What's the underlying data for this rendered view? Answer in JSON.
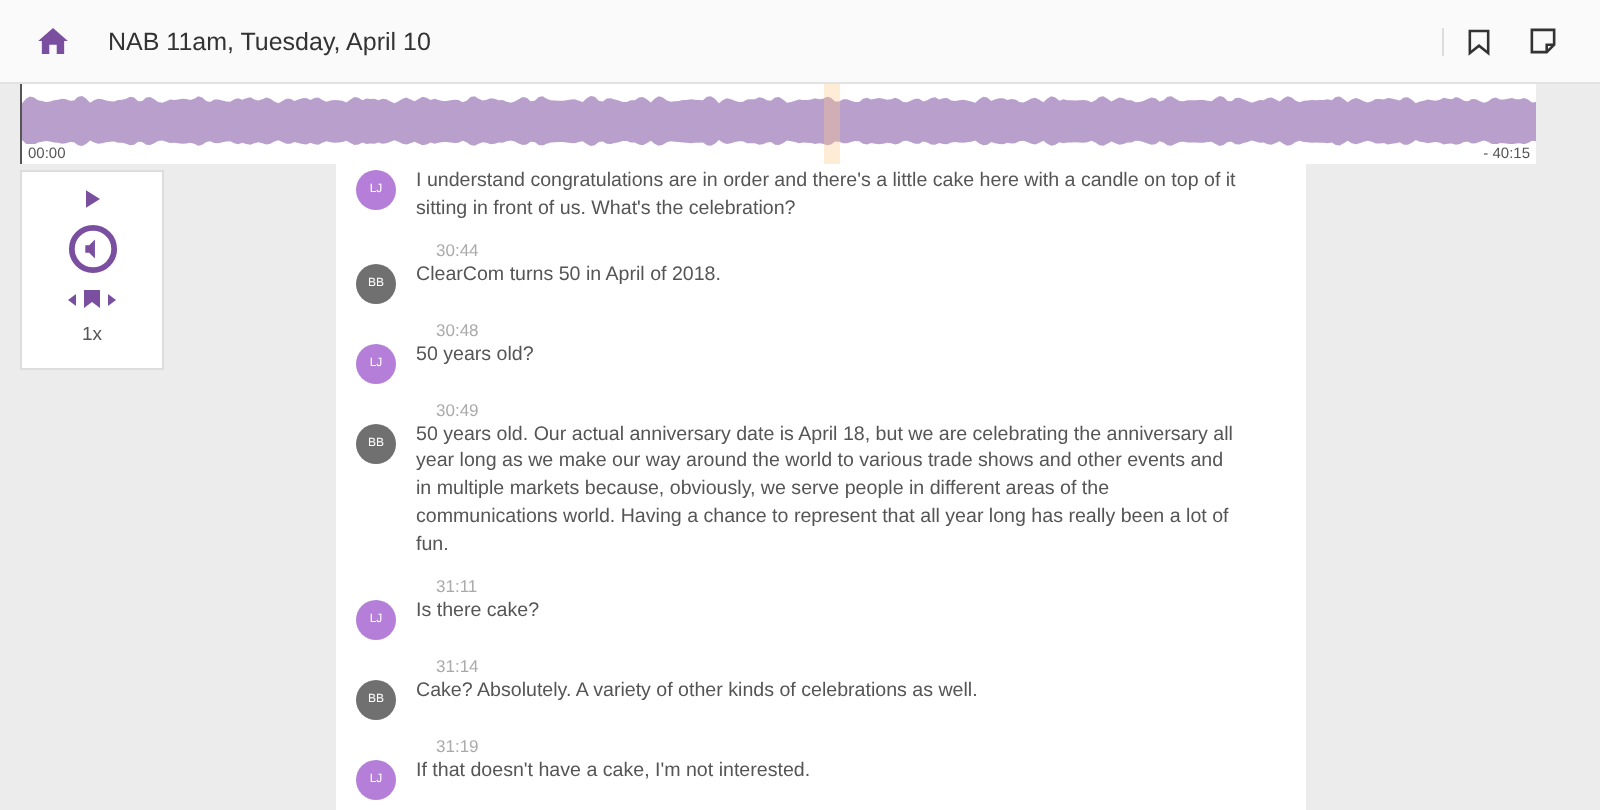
{
  "header": {
    "title": "NAB 11am, Tuesday, April 10"
  },
  "player": {
    "elapsed": "00:00",
    "remaining": "- 40:15",
    "level": 0.53,
    "speed": "1x"
  },
  "messages": [
    {
      "initials": "LJ",
      "color": "#b57fd9",
      "text": "I understand congratulations are in order and there's a little cake here with a candle on top of it sitting in front of us. What's the celebration?"
    },
    {
      "time": "30:44",
      "initials": "BB",
      "color": "#707070",
      "text": "ClearCom turns 50 in April of 2018."
    },
    {
      "time": "30:48",
      "initials": "LJ",
      "color": "#b57fd9",
      "text": "50 years old?"
    },
    {
      "time": "30:49",
      "initials": "BB",
      "color": "#707070",
      "text": "50 years old. Our actual anniversary date is April 18, but we are celebrating the anniversary all year long as we make our way around the world to various trade shows and other events and in multiple markets because, obviously, we serve people in different areas of the communications world. Having a chance to represent that all year long has really been a lot of fun."
    },
    {
      "time": "31:11",
      "initials": "LJ",
      "color": "#b57fd9",
      "text": "Is there cake?"
    },
    {
      "time": "31:14",
      "initials": "BB",
      "color": "#707070",
      "text": "Cake? Absolutely. A variety of other kinds of celebrations as well."
    },
    {
      "time": "31:19",
      "initials": "LJ",
      "color": "#b57fd9",
      "text": "If that doesn't have a cake, I'm not interested."
    }
  ]
}
